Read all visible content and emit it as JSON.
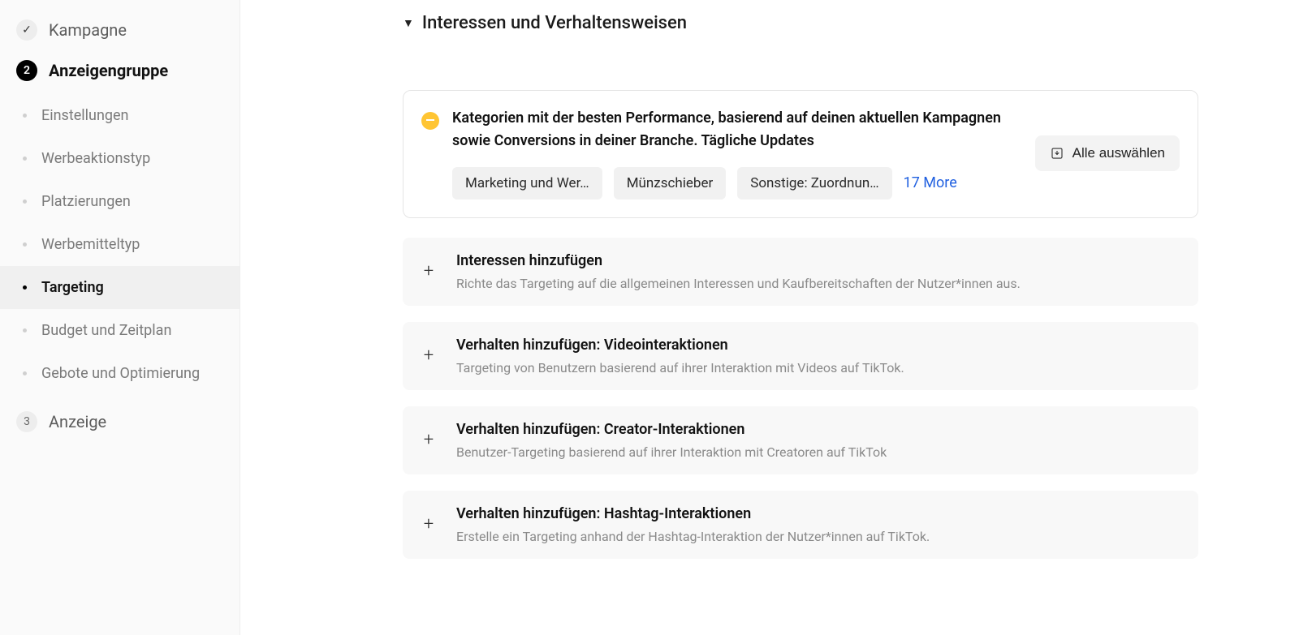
{
  "sidebar": {
    "steps": [
      {
        "id": "kampagne",
        "label": "Kampagne",
        "badge": "check",
        "active": false
      },
      {
        "id": "anzeigengruppe",
        "label": "Anzeigengruppe",
        "badge": "2",
        "active": true
      },
      {
        "id": "anzeige",
        "label": "Anzeige",
        "badge": "3",
        "active": false
      }
    ],
    "sub_items": [
      {
        "id": "einstellungen",
        "label": "Einstellungen",
        "active": false
      },
      {
        "id": "werbeaktionstyp",
        "label": "Werbeaktionstyp",
        "active": false
      },
      {
        "id": "platzierungen",
        "label": "Platzierungen",
        "active": false
      },
      {
        "id": "werbemitteltyp",
        "label": "Werbemitteltyp",
        "active": false
      },
      {
        "id": "targeting",
        "label": "Targeting",
        "active": true
      },
      {
        "id": "budget",
        "label": "Budget und Zeitplan",
        "active": false
      },
      {
        "id": "gebote",
        "label": "Gebote und Optimierung",
        "active": false
      }
    ]
  },
  "main": {
    "section_title": "Interessen und Verhaltensweisen",
    "recommendation": {
      "text": "Kategorien mit der besten Performance, basierend auf deinen aktuellen Kampagnen sowie Conversions in deiner Branche. Tägliche Updates",
      "tags": [
        "Marketing und Wer…",
        "Münzschieber",
        "Sonstige: Zuordnun…"
      ],
      "more_label": "17 More",
      "select_all_label": "Alle auswählen"
    },
    "add_rows": [
      {
        "id": "interessen",
        "title": "Interessen hinzufügen",
        "desc": "Richte das Targeting auf die allgemeinen Interessen und Kaufbereitschaften der Nutzer*innen aus."
      },
      {
        "id": "video",
        "title": "Verhalten hinzufügen: Videointeraktionen",
        "desc": "Targeting von Benutzern basierend auf ihrer Interaktion mit Videos auf TikTok."
      },
      {
        "id": "creator",
        "title": "Verhalten hinzufügen: Creator-Interaktionen",
        "desc": "Benutzer-Targeting basierend auf ihrer Interaktion mit Creatoren auf TikTok"
      },
      {
        "id": "hashtag",
        "title": "Verhalten hinzufügen: Hashtag-Interaktionen",
        "desc": "Erstelle ein Targeting anhand der Hashtag-Interaktion der Nutzer*innen auf TikTok."
      }
    ]
  }
}
